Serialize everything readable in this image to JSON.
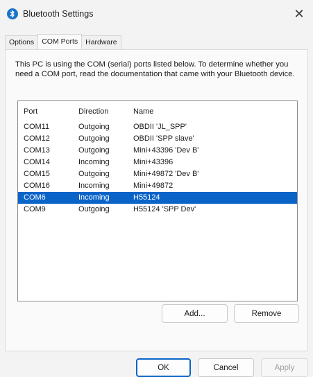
{
  "window": {
    "title": "Bluetooth Settings",
    "close_glyph": "✕",
    "icon": "bluetooth-icon"
  },
  "tabs": [
    {
      "label": "Options",
      "active": false
    },
    {
      "label": "COM Ports",
      "active": true
    },
    {
      "label": "Hardware",
      "active": false
    }
  ],
  "panel": {
    "description": "This PC is using the COM (serial) ports listed below. To determine whether you need a COM port, read the documentation that came with your Bluetooth device."
  },
  "list": {
    "headers": {
      "port": "Port",
      "direction": "Direction",
      "name": "Name"
    },
    "rows": [
      {
        "port": "COM11",
        "direction": "Outgoing",
        "name": "OBDII 'JL_SPP'"
      },
      {
        "port": "COM12",
        "direction": "Outgoing",
        "name": "OBDII 'SPP slave'"
      },
      {
        "port": "COM13",
        "direction": "Outgoing",
        "name": "Mini+43396 'Dev B'"
      },
      {
        "port": "COM14",
        "direction": "Incoming",
        "name": "Mini+43396"
      },
      {
        "port": "COM15",
        "direction": "Outgoing",
        "name": "Mini+49872 'Dev B'"
      },
      {
        "port": "COM16",
        "direction": "Incoming",
        "name": "Mini+49872"
      },
      {
        "port": "COM6",
        "direction": "Incoming",
        "name": "H55124",
        "selected": true
      },
      {
        "port": "COM9",
        "direction": "Outgoing",
        "name": "H55124 'SPP Dev'"
      }
    ]
  },
  "actions": {
    "add": "Add...",
    "remove": "Remove"
  },
  "dialog_buttons": {
    "ok": "OK",
    "cancel": "Cancel",
    "apply": "Apply"
  },
  "colors": {
    "selection": "#0a64c8",
    "bluetooth_icon": "#1a73c8"
  }
}
